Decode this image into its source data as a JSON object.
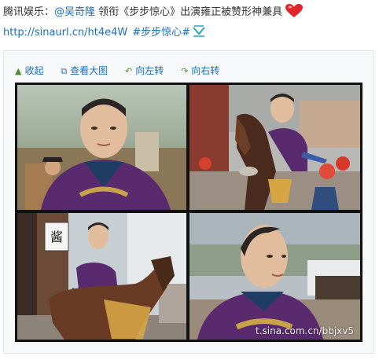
{
  "post": {
    "prefix": "腾讯娱乐：",
    "mention": "@吴奇隆",
    "text": " 领衔《步步惊心》出演雍正被赞形神兼具",
    "link": "http://sinaurl.cn/ht4e4W",
    "topic": "#步步惊心#"
  },
  "toolbar": {
    "collapse": "收起",
    "view_large": "查看大图",
    "rotate_left": "向左转",
    "rotate_right": "向右转"
  },
  "image": {
    "watermark": "t.sina.com.cn/bbjxv5",
    "alt_sign": "酱"
  },
  "colors": {
    "link": "#1b6fc0",
    "heart": "#e0262b",
    "robe": "#5a2a6e"
  }
}
